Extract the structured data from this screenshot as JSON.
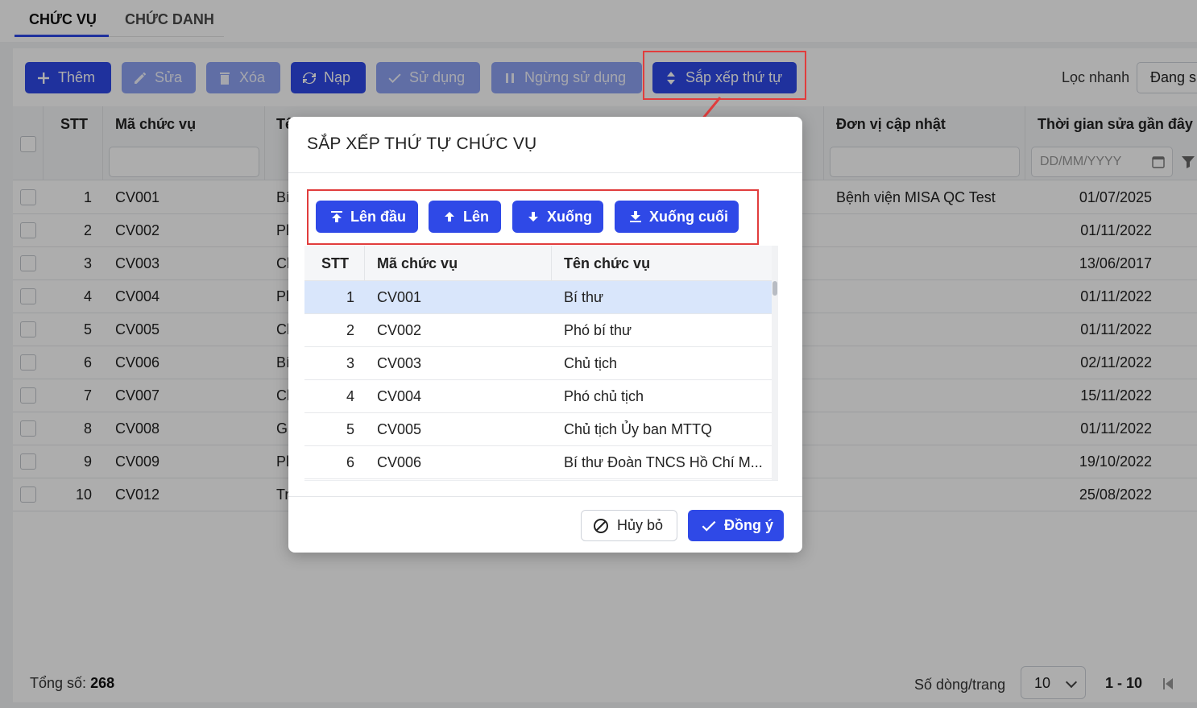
{
  "tabs": [
    "CHỨC VỤ",
    "CHỨC DANH"
  ],
  "toolbar": {
    "add": "Thêm",
    "edit": "Sửa",
    "delete": "Xóa",
    "reload": "Nạp",
    "use": "Sử dụng",
    "stop_use": "Ngừng sử dụng",
    "sort": "Sắp xếp thứ tự",
    "quick_filter_label": "Lọc nhanh",
    "quick_filter_value": "Đang s"
  },
  "grid": {
    "headers": {
      "stt": "STT",
      "code": "Mã chức vụ",
      "name": "Tê",
      "unit": "Đơn vị cập nhật",
      "modified": "Thời gian sửa gần đây"
    },
    "date_placeholder": "DD/MM/YYYY",
    "rows": [
      {
        "stt": "1",
        "code": "CV001",
        "name": "Bí",
        "unit": "Bệnh viện MISA QC Test",
        "date": "01/07/2025"
      },
      {
        "stt": "2",
        "code": "CV002",
        "name": "Pl",
        "unit": "",
        "date": "01/11/2022"
      },
      {
        "stt": "3",
        "code": "CV003",
        "name": "Cl",
        "unit": "",
        "date": "13/06/2017"
      },
      {
        "stt": "4",
        "code": "CV004",
        "name": "Pl",
        "unit": "",
        "date": "01/11/2022"
      },
      {
        "stt": "5",
        "code": "CV005",
        "name": "Cl",
        "unit": "",
        "date": "01/11/2022"
      },
      {
        "stt": "6",
        "code": "CV006",
        "name": "Bí",
        "unit": "",
        "date": "02/11/2022"
      },
      {
        "stt": "7",
        "code": "CV007",
        "name": "Cl",
        "unit": "",
        "date": "15/11/2022"
      },
      {
        "stt": "8",
        "code": "CV008",
        "name": "Gi",
        "unit": "",
        "date": "01/11/2022"
      },
      {
        "stt": "9",
        "code": "CV009",
        "name": "Pl",
        "unit": "",
        "date": "19/10/2022"
      },
      {
        "stt": "10",
        "code": "CV012",
        "name": "Tr",
        "unit": "",
        "date": "25/08/2022"
      }
    ]
  },
  "footer": {
    "total_label": "Tổng số:",
    "total_value": "268",
    "rows_per_page_label": "Số dòng/trang",
    "rows_per_page": "10",
    "page_range": "1 - 10"
  },
  "dialog": {
    "title": "SẮP XẾP THỨ TỰ CHỨC VỤ",
    "buttons": {
      "to_top": "Lên đầu",
      "up": "Lên",
      "down": "Xuống",
      "to_bottom": "Xuống cuối"
    },
    "headers": {
      "stt": "STT",
      "code": "Mã chức vụ",
      "name": "Tên chức vụ"
    },
    "rows": [
      {
        "stt": "1",
        "code": "CV001",
        "name": "Bí thư"
      },
      {
        "stt": "2",
        "code": "CV002",
        "name": "Phó bí thư"
      },
      {
        "stt": "3",
        "code": "CV003",
        "name": "Chủ tịch"
      },
      {
        "stt": "4",
        "code": "CV004",
        "name": "Phó chủ tịch"
      },
      {
        "stt": "5",
        "code": "CV005",
        "name": "Chủ tịch Ủy ban MTTQ"
      },
      {
        "stt": "6",
        "code": "CV006",
        "name": "Bí thư Đoàn TNCS Hồ Chí M..."
      }
    ],
    "cancel": "Hủy bỏ",
    "ok": "Đồng ý"
  },
  "colors": {
    "primary": "#2f49e7",
    "primary_disabled": "#8ea3f3",
    "highlight": "#e13d3d",
    "selected_row": "#d9e6fb"
  }
}
